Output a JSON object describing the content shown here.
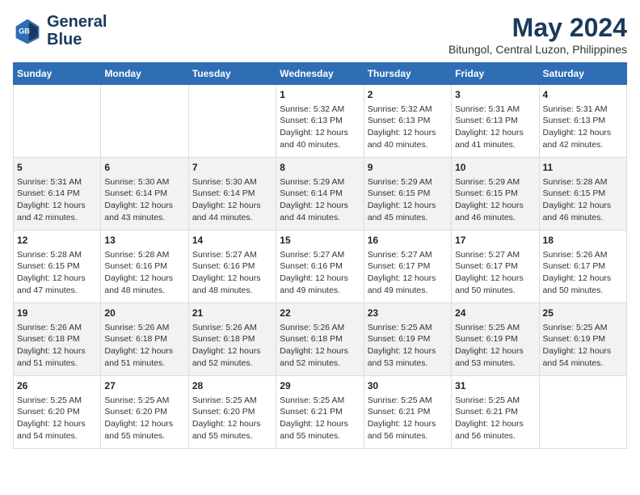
{
  "logo": {
    "line1": "General",
    "line2": "Blue"
  },
  "title": "May 2024",
  "subtitle": "Bitungol, Central Luzon, Philippines",
  "header_days": [
    "Sunday",
    "Monday",
    "Tuesday",
    "Wednesday",
    "Thursday",
    "Friday",
    "Saturday"
  ],
  "weeks": [
    [
      {
        "day": "",
        "content": ""
      },
      {
        "day": "",
        "content": ""
      },
      {
        "day": "",
        "content": ""
      },
      {
        "day": "1",
        "content": "Sunrise: 5:32 AM\nSunset: 6:13 PM\nDaylight: 12 hours\nand 40 minutes."
      },
      {
        "day": "2",
        "content": "Sunrise: 5:32 AM\nSunset: 6:13 PM\nDaylight: 12 hours\nand 40 minutes."
      },
      {
        "day": "3",
        "content": "Sunrise: 5:31 AM\nSunset: 6:13 PM\nDaylight: 12 hours\nand 41 minutes."
      },
      {
        "day": "4",
        "content": "Sunrise: 5:31 AM\nSunset: 6:13 PM\nDaylight: 12 hours\nand 42 minutes."
      }
    ],
    [
      {
        "day": "5",
        "content": "Sunrise: 5:31 AM\nSunset: 6:14 PM\nDaylight: 12 hours\nand 42 minutes."
      },
      {
        "day": "6",
        "content": "Sunrise: 5:30 AM\nSunset: 6:14 PM\nDaylight: 12 hours\nand 43 minutes."
      },
      {
        "day": "7",
        "content": "Sunrise: 5:30 AM\nSunset: 6:14 PM\nDaylight: 12 hours\nand 44 minutes."
      },
      {
        "day": "8",
        "content": "Sunrise: 5:29 AM\nSunset: 6:14 PM\nDaylight: 12 hours\nand 44 minutes."
      },
      {
        "day": "9",
        "content": "Sunrise: 5:29 AM\nSunset: 6:15 PM\nDaylight: 12 hours\nand 45 minutes."
      },
      {
        "day": "10",
        "content": "Sunrise: 5:29 AM\nSunset: 6:15 PM\nDaylight: 12 hours\nand 46 minutes."
      },
      {
        "day": "11",
        "content": "Sunrise: 5:28 AM\nSunset: 6:15 PM\nDaylight: 12 hours\nand 46 minutes."
      }
    ],
    [
      {
        "day": "12",
        "content": "Sunrise: 5:28 AM\nSunset: 6:15 PM\nDaylight: 12 hours\nand 47 minutes."
      },
      {
        "day": "13",
        "content": "Sunrise: 5:28 AM\nSunset: 6:16 PM\nDaylight: 12 hours\nand 48 minutes."
      },
      {
        "day": "14",
        "content": "Sunrise: 5:27 AM\nSunset: 6:16 PM\nDaylight: 12 hours\nand 48 minutes."
      },
      {
        "day": "15",
        "content": "Sunrise: 5:27 AM\nSunset: 6:16 PM\nDaylight: 12 hours\nand 49 minutes."
      },
      {
        "day": "16",
        "content": "Sunrise: 5:27 AM\nSunset: 6:17 PM\nDaylight: 12 hours\nand 49 minutes."
      },
      {
        "day": "17",
        "content": "Sunrise: 5:27 AM\nSunset: 6:17 PM\nDaylight: 12 hours\nand 50 minutes."
      },
      {
        "day": "18",
        "content": "Sunrise: 5:26 AM\nSunset: 6:17 PM\nDaylight: 12 hours\nand 50 minutes."
      }
    ],
    [
      {
        "day": "19",
        "content": "Sunrise: 5:26 AM\nSunset: 6:18 PM\nDaylight: 12 hours\nand 51 minutes."
      },
      {
        "day": "20",
        "content": "Sunrise: 5:26 AM\nSunset: 6:18 PM\nDaylight: 12 hours\nand 51 minutes."
      },
      {
        "day": "21",
        "content": "Sunrise: 5:26 AM\nSunset: 6:18 PM\nDaylight: 12 hours\nand 52 minutes."
      },
      {
        "day": "22",
        "content": "Sunrise: 5:26 AM\nSunset: 6:18 PM\nDaylight: 12 hours\nand 52 minutes."
      },
      {
        "day": "23",
        "content": "Sunrise: 5:25 AM\nSunset: 6:19 PM\nDaylight: 12 hours\nand 53 minutes."
      },
      {
        "day": "24",
        "content": "Sunrise: 5:25 AM\nSunset: 6:19 PM\nDaylight: 12 hours\nand 53 minutes."
      },
      {
        "day": "25",
        "content": "Sunrise: 5:25 AM\nSunset: 6:19 PM\nDaylight: 12 hours\nand 54 minutes."
      }
    ],
    [
      {
        "day": "26",
        "content": "Sunrise: 5:25 AM\nSunset: 6:20 PM\nDaylight: 12 hours\nand 54 minutes."
      },
      {
        "day": "27",
        "content": "Sunrise: 5:25 AM\nSunset: 6:20 PM\nDaylight: 12 hours\nand 55 minutes."
      },
      {
        "day": "28",
        "content": "Sunrise: 5:25 AM\nSunset: 6:20 PM\nDaylight: 12 hours\nand 55 minutes."
      },
      {
        "day": "29",
        "content": "Sunrise: 5:25 AM\nSunset: 6:21 PM\nDaylight: 12 hours\nand 55 minutes."
      },
      {
        "day": "30",
        "content": "Sunrise: 5:25 AM\nSunset: 6:21 PM\nDaylight: 12 hours\nand 56 minutes."
      },
      {
        "day": "31",
        "content": "Sunrise: 5:25 AM\nSunset: 6:21 PM\nDaylight: 12 hours\nand 56 minutes."
      },
      {
        "day": "",
        "content": ""
      }
    ]
  ]
}
